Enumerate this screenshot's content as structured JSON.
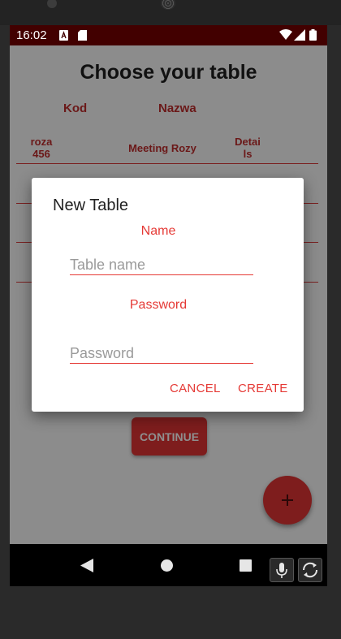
{
  "status_bar": {
    "time": "16:02"
  },
  "app": {
    "title": "Choose your table",
    "headers": {
      "code": "Kod",
      "name": "Nazwa"
    },
    "first_row": {
      "code": "roza 456",
      "name": "Meeting Rozy",
      "details": "Detai ls"
    },
    "continue_label": "CONTINUE",
    "fab_icon": "plus-icon"
  },
  "dialog": {
    "title": "New Table",
    "name_label": "Name",
    "name_placeholder": "Table name",
    "password_label": "Password",
    "password_placeholder": "Password",
    "cancel_label": "CANCEL",
    "create_label": "CREATE"
  },
  "nav": {
    "back_icon": "back-icon",
    "home_icon": "home-icon",
    "recents_icon": "recents-icon"
  },
  "colors": {
    "accent": "#e53935",
    "status_bar": "#420000",
    "dark_red": "#7e1d1d"
  }
}
